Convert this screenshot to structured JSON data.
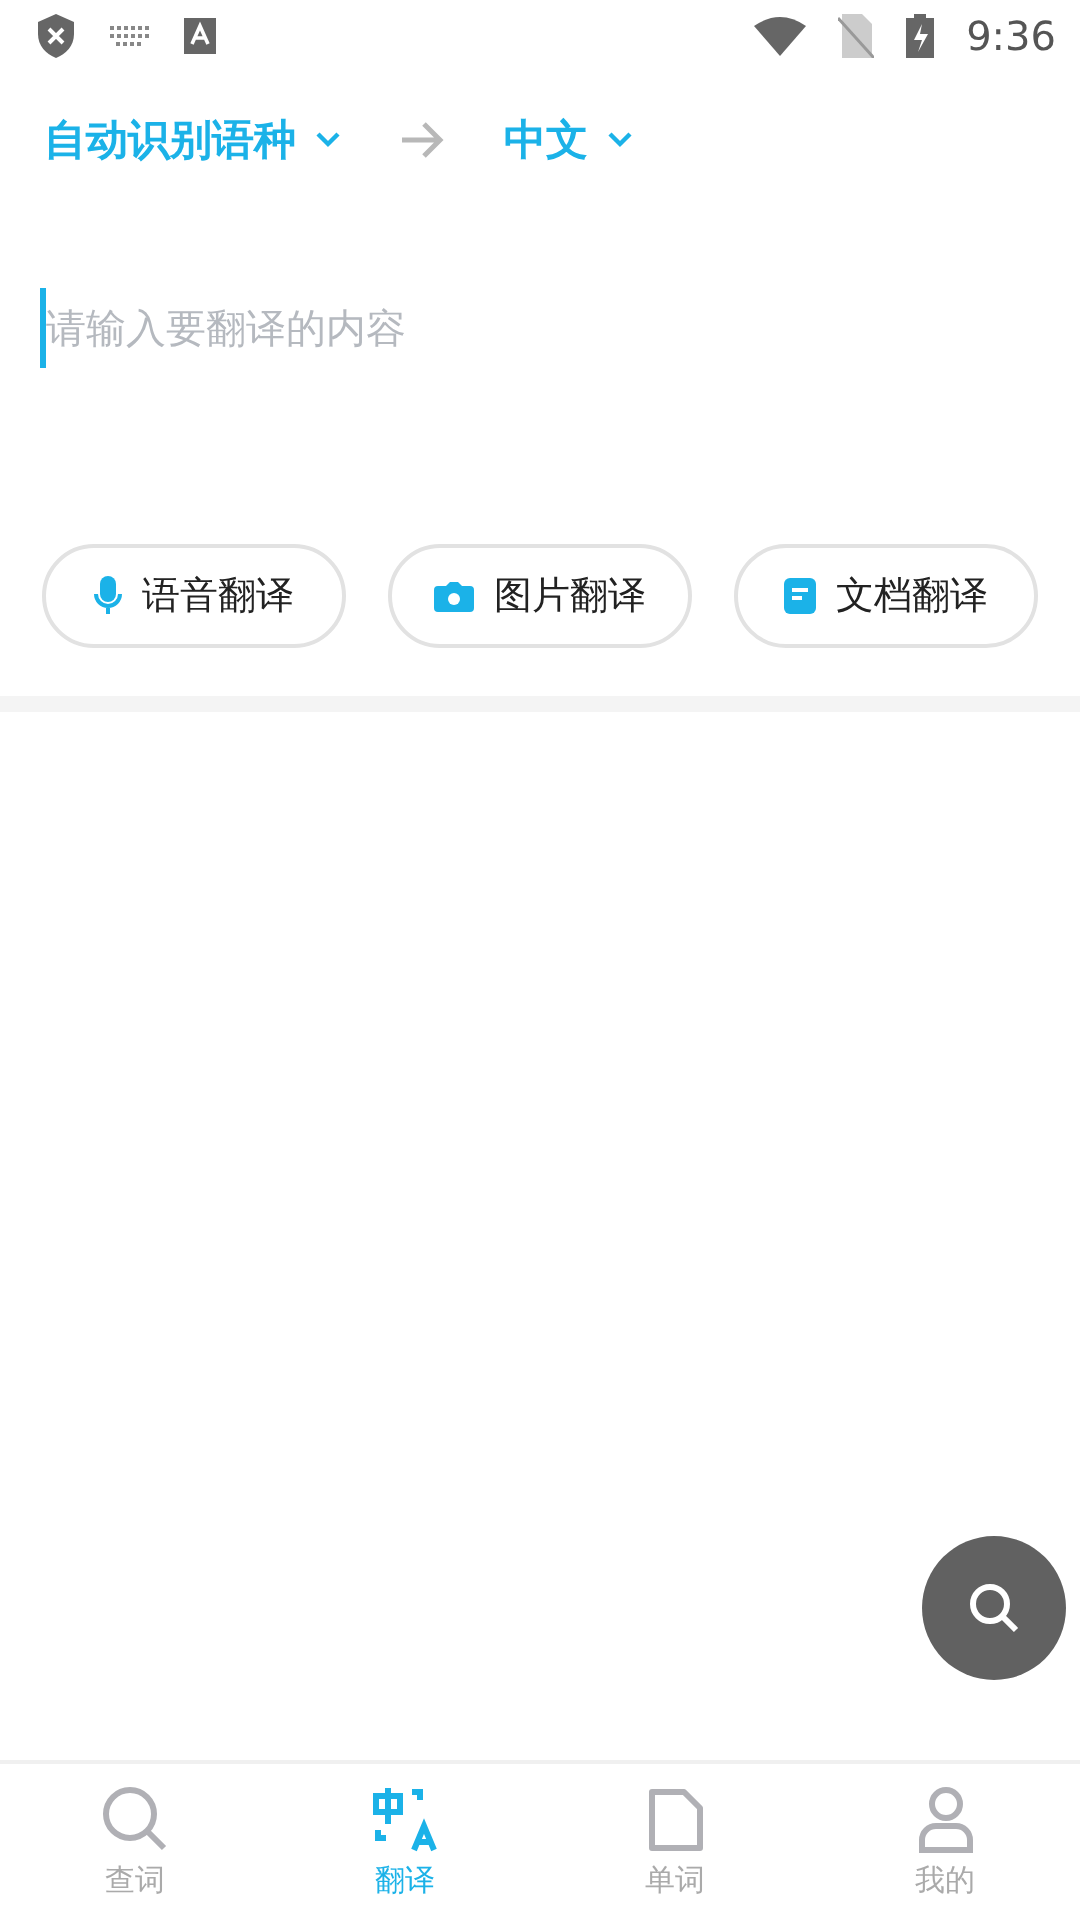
{
  "status_bar": {
    "time": "9:36"
  },
  "languages": {
    "source": "自动识别语种",
    "target": "中文"
  },
  "input": {
    "placeholder": "请输入要翻译的内容"
  },
  "actions": [
    {
      "kind": "voice",
      "label": "语音翻译"
    },
    {
      "kind": "image",
      "label": "图片翻译"
    },
    {
      "kind": "document",
      "label": "文档翻译"
    }
  ],
  "nav": [
    {
      "kind": "lookup",
      "label": "查词",
      "selected": false
    },
    {
      "kind": "translate",
      "label": "翻译",
      "selected": true
    },
    {
      "kind": "words",
      "label": "单词",
      "selected": false
    },
    {
      "kind": "profile",
      "label": "我的",
      "selected": false
    }
  ]
}
